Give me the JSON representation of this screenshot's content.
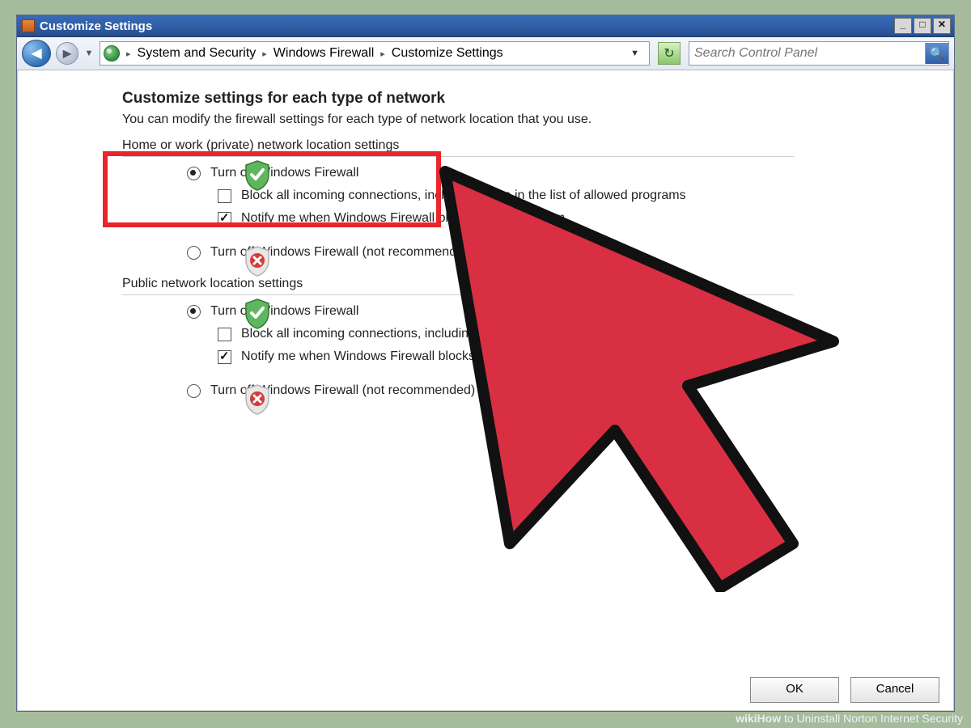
{
  "window": {
    "title": "Customize Settings",
    "win_buttons": {
      "min": "_",
      "max": "□",
      "close": "✕"
    }
  },
  "nav": {
    "crumbs": [
      "System and Security",
      "Windows Firewall",
      "Customize Settings"
    ],
    "search_placeholder": "Search Control Panel"
  },
  "page": {
    "heading": "Customize settings for each type of network",
    "subtext": "You can modify the firewall settings for each type of network location that you use."
  },
  "sections": {
    "private": {
      "label": "Home or work (private) network location settings",
      "on": {
        "radio_label": "Turn on Windows Firewall",
        "block_label": "Block all incoming connections, including those in the list of allowed programs",
        "notify_label": "Notify me when Windows Firewall blocks a new program"
      },
      "off": {
        "radio_label": "Turn off Windows Firewall (not recommended)"
      }
    },
    "public": {
      "label": "Public network location settings",
      "on": {
        "radio_label": "Turn on Windows Firewall",
        "block_label": "Block all incoming connections, including those in the list",
        "notify_label": "Notify me when Windows Firewall blocks a new program"
      },
      "off": {
        "radio_label": "Turn off Windows Firewall (not recommended)"
      }
    }
  },
  "buttons": {
    "ok": "OK",
    "cancel": "Cancel"
  },
  "footer": {
    "brand": "wikiHow",
    "suffix": " to Uninstall Norton Internet Security"
  }
}
